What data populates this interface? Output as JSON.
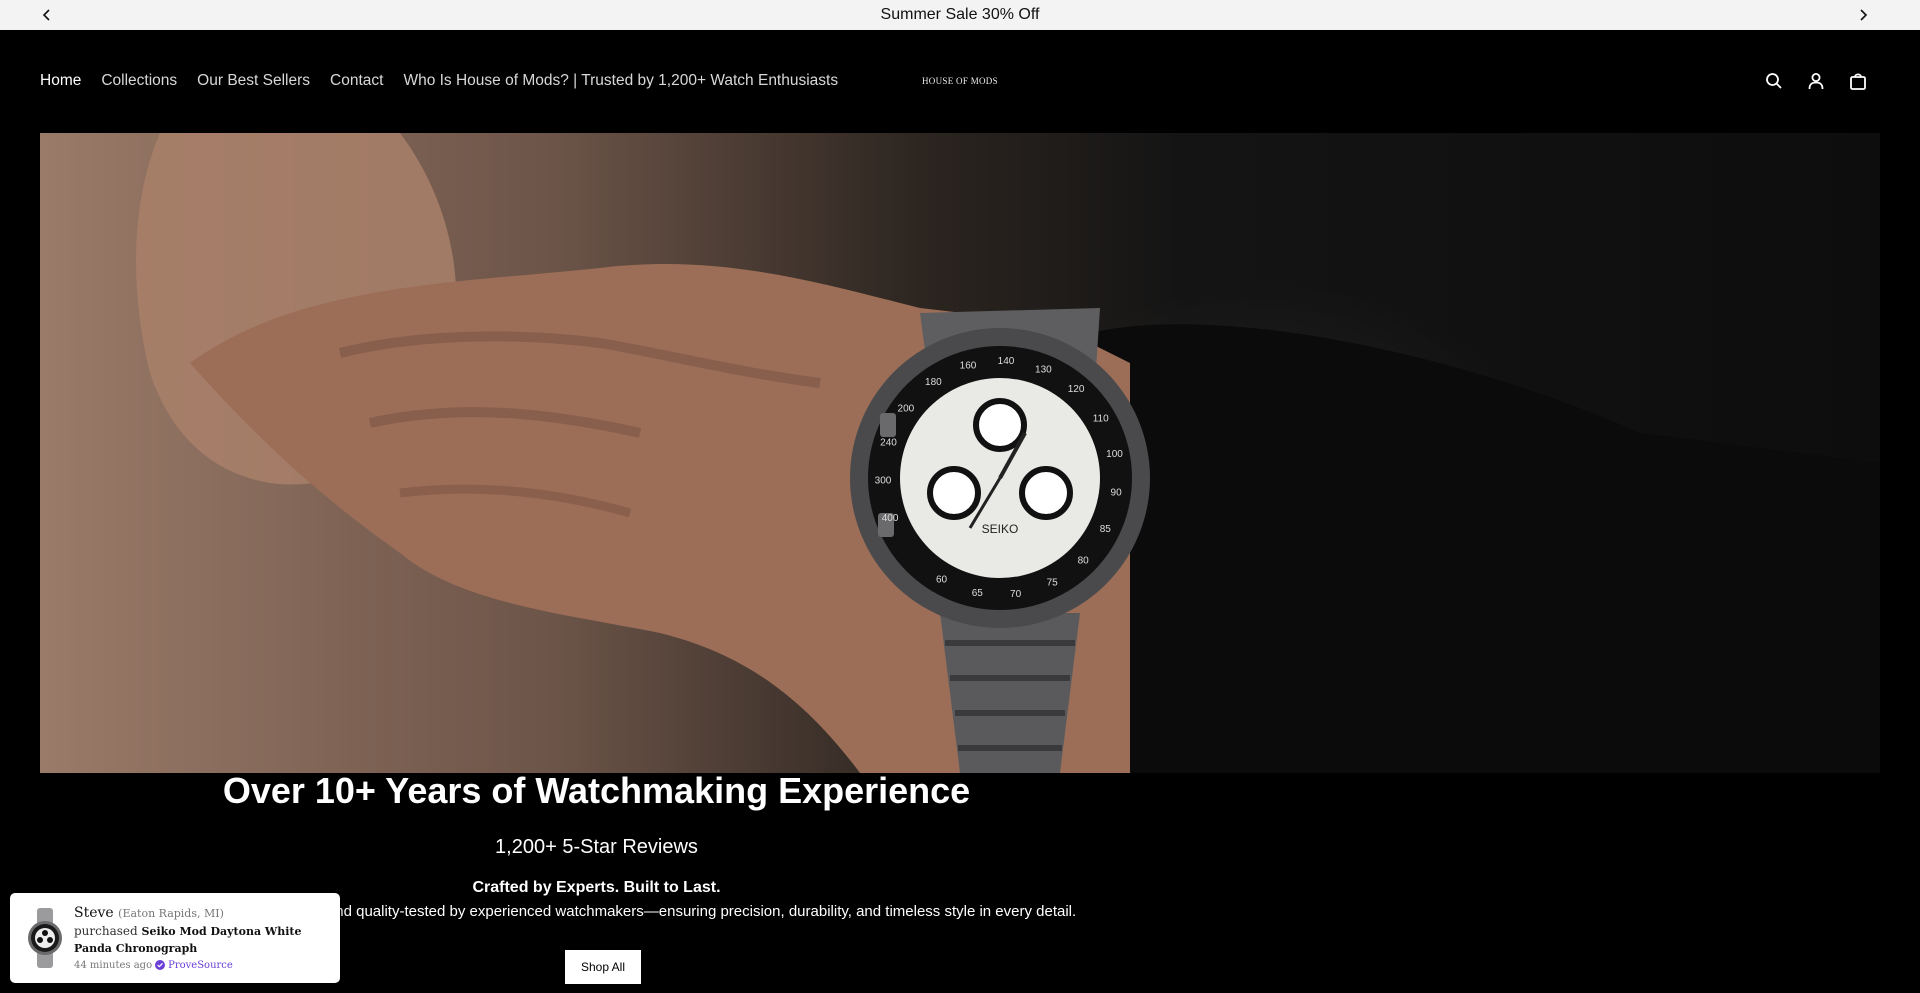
{
  "announcement": {
    "text": "Summer Sale 30% Off",
    "prev_icon": "chevron-left-icon",
    "next_icon": "chevron-right-icon"
  },
  "header": {
    "nav": [
      {
        "label": "Home",
        "active": true
      },
      {
        "label": "Collections"
      },
      {
        "label": "Our Best Sellers"
      },
      {
        "label": "Contact"
      },
      {
        "label": "Who Is House of Mods? | Trusted by 1,200+ Watch Enthusiasts"
      }
    ],
    "logo": "HOUSE OF MODS",
    "icons": [
      "search-icon",
      "account-icon",
      "cart-icon"
    ]
  },
  "hero": {
    "dial_brand": "SEIKO",
    "bezel_numbers": [
      "400",
      "300",
      "240",
      "200",
      "180",
      "160",
      "140",
      "130",
      "120",
      "110",
      "100",
      "90",
      "85",
      "80",
      "75",
      "70",
      "65",
      "60"
    ]
  },
  "content": {
    "headline": "Over 10+ Years of Watchmaking Experience",
    "reviews": "1,200+ 5-Star Reviews",
    "tagline": "Crafted by Experts. Built to Last.",
    "description": "Each timepiece is hand-crafted and quality-tested by experienced watchmakers—ensuring precision, durability, and timeless style in every detail.",
    "cta": "Shop All"
  },
  "popup": {
    "name": "Steve",
    "location": "(Eaton Rapids, MI)",
    "action": "purchased",
    "product": "Seiko Mod Daytona White Panda Chronograph",
    "time": "44 minutes ago",
    "source": "ProveSource"
  }
}
